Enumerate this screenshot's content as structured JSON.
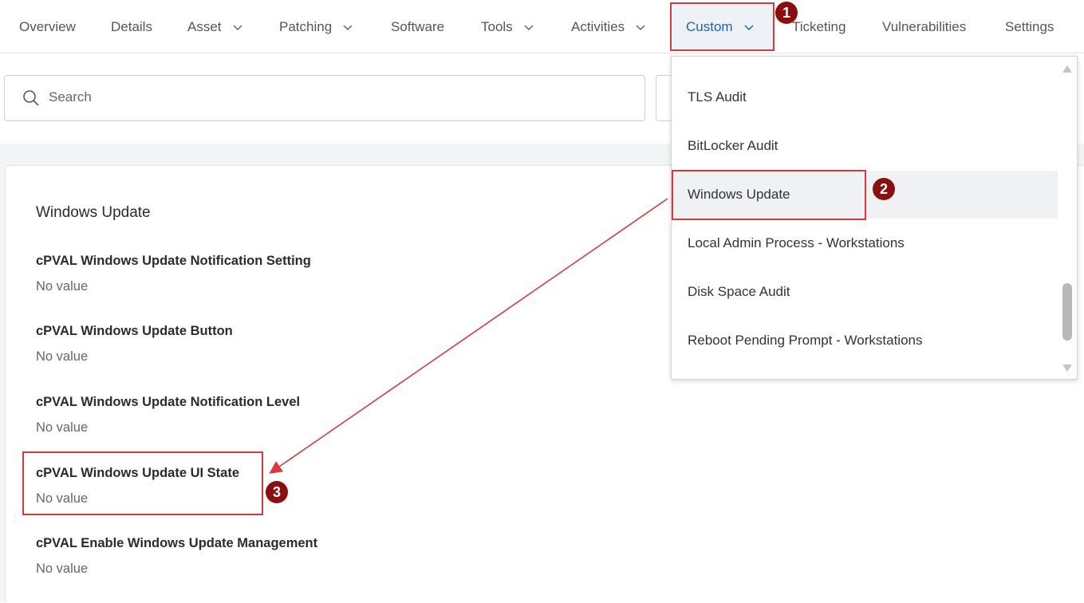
{
  "nav": {
    "tabs": [
      {
        "label": "Overview",
        "dropdown": false
      },
      {
        "label": "Details",
        "dropdown": false
      },
      {
        "label": "Asset",
        "dropdown": true
      },
      {
        "label": "Patching",
        "dropdown": true
      },
      {
        "label": "Software",
        "dropdown": false
      },
      {
        "label": "Tools",
        "dropdown": true
      },
      {
        "label": "Activities",
        "dropdown": true
      },
      {
        "label": "Custom",
        "dropdown": true,
        "active": true
      },
      {
        "label": "Ticketing",
        "dropdown": false
      },
      {
        "label": "Vulnerabilities",
        "dropdown": false
      },
      {
        "label": "Settings",
        "dropdown": false
      }
    ]
  },
  "search": {
    "placeholder": "Search"
  },
  "section": {
    "title": "Windows Update",
    "fields": [
      {
        "label": "cPVAL Windows Update Notification Setting",
        "value": "No value"
      },
      {
        "label": "cPVAL Windows Update Button",
        "value": "No value"
      },
      {
        "label": "cPVAL Windows Update Notification Level",
        "value": "No value"
      },
      {
        "label": "cPVAL Windows Update UI State",
        "value": "No value"
      },
      {
        "label": "cPVAL Enable Windows Update Management",
        "value": "No value"
      }
    ]
  },
  "custom_menu": {
    "items": [
      {
        "label": "TLS Audit"
      },
      {
        "label": "BitLocker Audit"
      },
      {
        "label": "Windows Update",
        "hovered": true
      },
      {
        "label": "Local Admin Process - Workstations"
      },
      {
        "label": "Disk Space Audit"
      },
      {
        "label": "Reboot Pending Prompt - Workstations"
      }
    ]
  },
  "annotations": {
    "steps": [
      "1",
      "2",
      "3"
    ],
    "color": "#d9383f",
    "badge_color": "#8a1010"
  },
  "colors": {
    "accent": "#1f63a8",
    "text": "#2b2b2b",
    "muted": "#666666"
  }
}
